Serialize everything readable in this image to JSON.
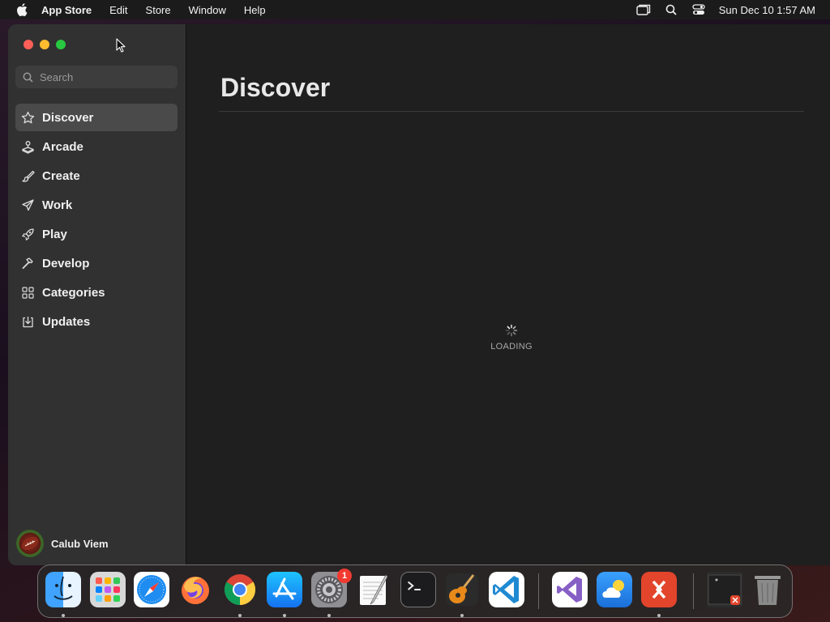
{
  "menubar": {
    "app_name": "App Store",
    "menus": [
      "Edit",
      "Store",
      "Window",
      "Help"
    ],
    "clock": "Sun Dec 10  1:57 AM",
    "status_icons": [
      "screen-mirroring-icon",
      "spotlight-search-icon",
      "control-center-icon"
    ]
  },
  "sidebar": {
    "search_placeholder": "Search",
    "items": [
      {
        "label": "Discover",
        "icon": "star-icon",
        "active": true
      },
      {
        "label": "Arcade",
        "icon": "joystick-icon",
        "active": false
      },
      {
        "label": "Create",
        "icon": "brush-icon",
        "active": false
      },
      {
        "label": "Work",
        "icon": "paper-plane-icon",
        "active": false
      },
      {
        "label": "Play",
        "icon": "rocket-icon",
        "active": false
      },
      {
        "label": "Develop",
        "icon": "hammer-icon",
        "active": false
      },
      {
        "label": "Categories",
        "icon": "grid-icon",
        "active": false
      },
      {
        "label": "Updates",
        "icon": "download-icon",
        "active": false
      }
    ],
    "account_name": "Calub Viem"
  },
  "main": {
    "title": "Discover",
    "loading_text": "LOADING"
  },
  "dock": {
    "apps": [
      {
        "name": "Finder",
        "running": true
      },
      {
        "name": "Launchpad",
        "running": false
      },
      {
        "name": "Safari",
        "running": false
      },
      {
        "name": "Firefox",
        "running": false
      },
      {
        "name": "Google Chrome",
        "running": true
      },
      {
        "name": "App Store",
        "running": true
      },
      {
        "name": "System Settings",
        "running": true,
        "badge": "1"
      },
      {
        "name": "TextEdit",
        "running": false
      },
      {
        "name": "Terminal",
        "running": false
      },
      {
        "name": "GarageBand",
        "running": true
      },
      {
        "name": "Visual Studio Code",
        "running": false
      },
      {
        "name": "Visual Studio",
        "running": false
      },
      {
        "name": "iCloud Weather",
        "running": false
      },
      {
        "name": "Remote Desktop",
        "running": true
      },
      {
        "name": "Screen Recording",
        "running": false
      },
      {
        "name": "Trash",
        "running": false
      }
    ]
  },
  "colors": {
    "close": "#fe5f57",
    "minimize": "#febc2e",
    "zoom": "#28c840",
    "badge": "#f23a30"
  }
}
